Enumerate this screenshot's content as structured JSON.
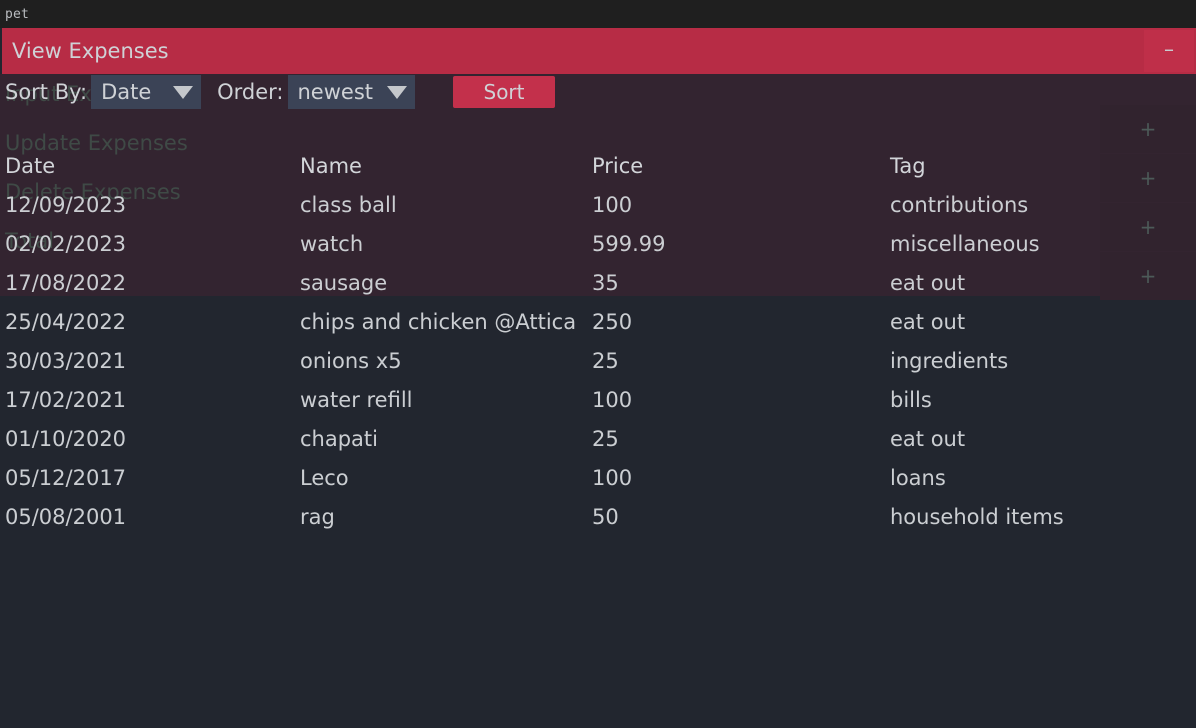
{
  "terminal": {
    "text": "pet"
  },
  "window": {
    "title": "View Expenses",
    "minimize_label": "–"
  },
  "controls": {
    "sort_by_label": "Sort By:",
    "sort_by_value": "Date",
    "order_label": "Order:",
    "order_value": "newest",
    "sort_button_label": "Sort",
    "caret_icon": "chevron-down-icon"
  },
  "background_menu": {
    "items": [
      {
        "label": "Input Expenses",
        "plus": "+"
      },
      {
        "label": "Update Expenses",
        "plus": "+"
      },
      {
        "label": "Delete Expenses",
        "plus": "+"
      },
      {
        "label": "Total",
        "plus": "+"
      }
    ]
  },
  "table": {
    "columns": [
      "Date",
      "Name",
      "Price",
      "Tag"
    ],
    "rows": [
      {
        "date": "12/09/2023",
        "name": "class ball",
        "price": "100",
        "tag": "contributions"
      },
      {
        "date": "02/02/2023",
        "name": "watch",
        "price": "599.99",
        "tag": "miscellaneous"
      },
      {
        "date": "17/08/2022",
        "name": "sausage",
        "price": "35",
        "tag": "eat out"
      },
      {
        "date": "25/04/2022",
        "name": "chips and chicken @Attica",
        "price": "250",
        "tag": "eat out"
      },
      {
        "date": "30/03/2021",
        "name": "onions x5",
        "price": "25",
        "tag": "ingredients"
      },
      {
        "date": "17/02/2021",
        "name": "water refill",
        "price": "100",
        "tag": "bills"
      },
      {
        "date": "01/10/2020",
        "name": "chapati",
        "price": "25",
        "tag": "eat out"
      },
      {
        "date": "05/12/2017",
        "name": "Leco",
        "price": "100",
        "tag": "loans"
      },
      {
        "date": "05/08/2001",
        "name": "rag",
        "price": "50",
        "tag": "household items"
      }
    ]
  },
  "colors": {
    "accent_red": "#b72c45",
    "button_red": "#c3304b",
    "panel_tint": "#332430",
    "app_background": "#22262f",
    "select_background": "#3b4356",
    "text": "#cbced2"
  }
}
